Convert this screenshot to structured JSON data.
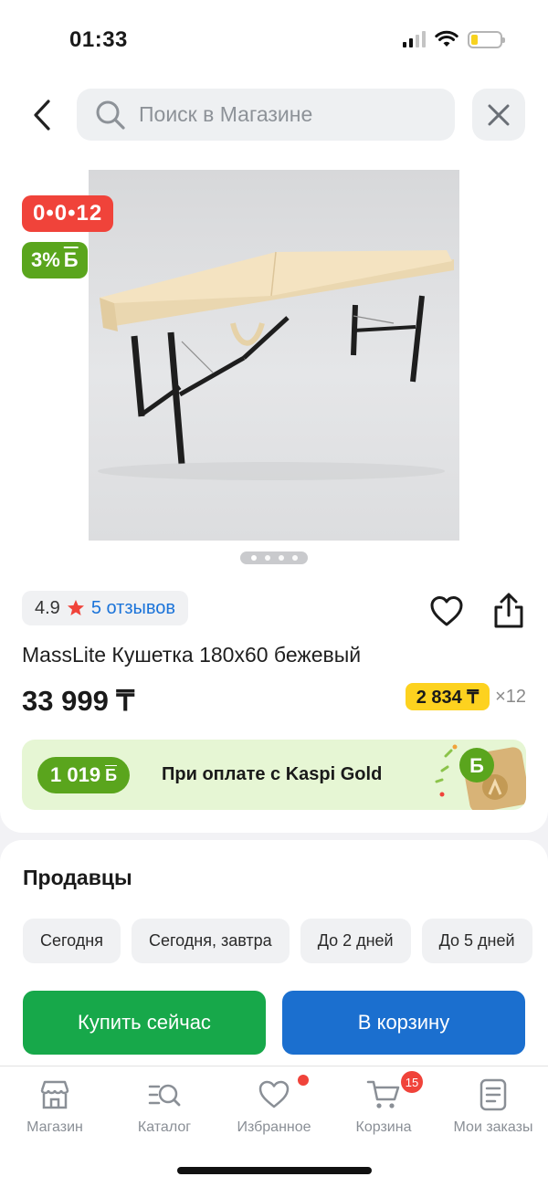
{
  "status_bar": {
    "time": "01:33",
    "battery_level": 0.22,
    "battery_color": "#f7d21f"
  },
  "header": {
    "back_icon": "chevron-left-icon",
    "search_placeholder": "Поиск в Магазине",
    "close_icon": "close-icon"
  },
  "product": {
    "timer_badge": "0•0•12",
    "bonus_badge": "3%",
    "bonus_currency": "Б",
    "image_pages": 4,
    "active_page": 1,
    "rating": "4.9",
    "reviews_link": "5 отзывов",
    "title": "MassLite Кушетка 180x60 бежевый",
    "price": "33 999 ₸",
    "installment_amount": "2 834 ₸",
    "installment_months": "×12",
    "gold_bonus": "1 019",
    "gold_bonus_currency": "Б",
    "gold_text": "При оплате с Kaspi Gold"
  },
  "sellers": {
    "title": "Продавцы",
    "filters": [
      "Сегодня",
      "Сегодня, завтра",
      "До 2 дней",
      "До 5 дней"
    ],
    "buy_now": "Купить сейчас",
    "add_to_cart": "В корзину"
  },
  "tab_bar": {
    "items": [
      {
        "label": "Магазин",
        "icon": "store-icon"
      },
      {
        "label": "Каталог",
        "icon": "catalog-icon"
      },
      {
        "label": "Избранное",
        "icon": "heart-icon"
      },
      {
        "label": "Корзина",
        "icon": "cart-icon"
      },
      {
        "label": "Мои заказы",
        "icon": "orders-icon"
      }
    ],
    "cart_badge": "15"
  },
  "colors": {
    "accent_red": "#f0433a",
    "bonus_green": "#5aa51d",
    "buy_green": "#17a84a",
    "cart_blue": "#1b6fcf",
    "installment_yellow": "#fdd21f",
    "link_blue": "#1a73d9"
  }
}
